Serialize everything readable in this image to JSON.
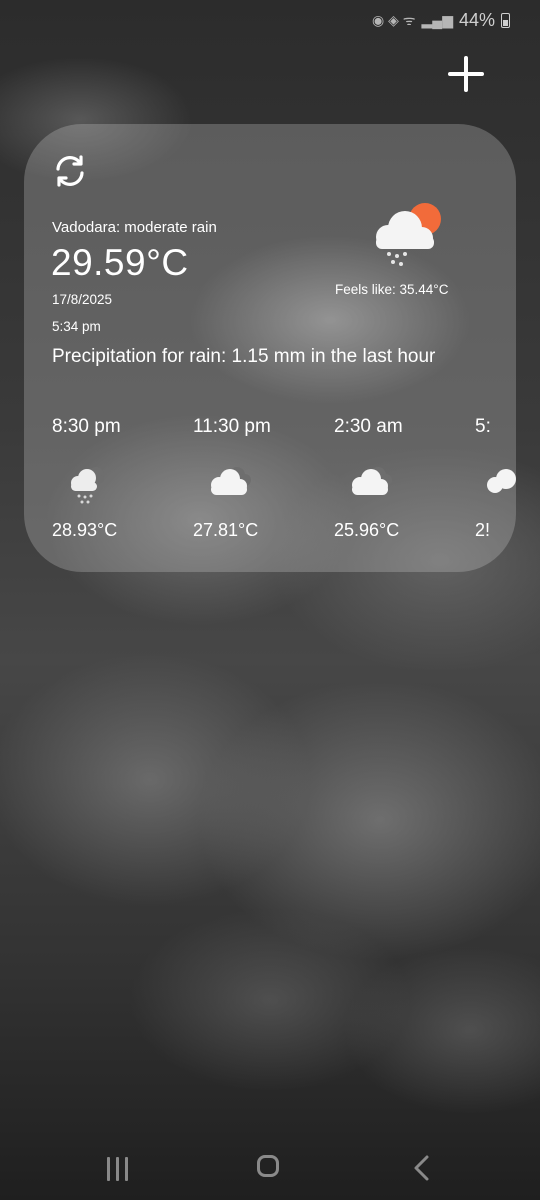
{
  "status_bar": {
    "battery": "44%"
  },
  "weather": {
    "location_desc": "Vadodara: moderate rain",
    "temperature": "29.59°C",
    "date": "17/8/2025",
    "time": "5:34 pm",
    "feels_like": "Feels like: 35.44°C",
    "precipitation": "Precipitation for rain: 1.15 mm in the last hour",
    "icon": "rain-cloud-sun-icon"
  },
  "forecast": [
    {
      "time": "8:30 pm",
      "temp": "28.93°C",
      "icon": "rain-cloud-icon"
    },
    {
      "time": "11:30 pm",
      "temp": "27.81°C",
      "icon": "cloud-icon"
    },
    {
      "time": "2:30 am",
      "temp": "25.96°C",
      "icon": "cloud-icon"
    },
    {
      "time": "5:",
      "temp": "2!",
      "icon": "cloud-icon"
    }
  ],
  "colors": {
    "sun": "#f26b3a",
    "card": "#d2d2d2",
    "text": "#ffffff"
  }
}
